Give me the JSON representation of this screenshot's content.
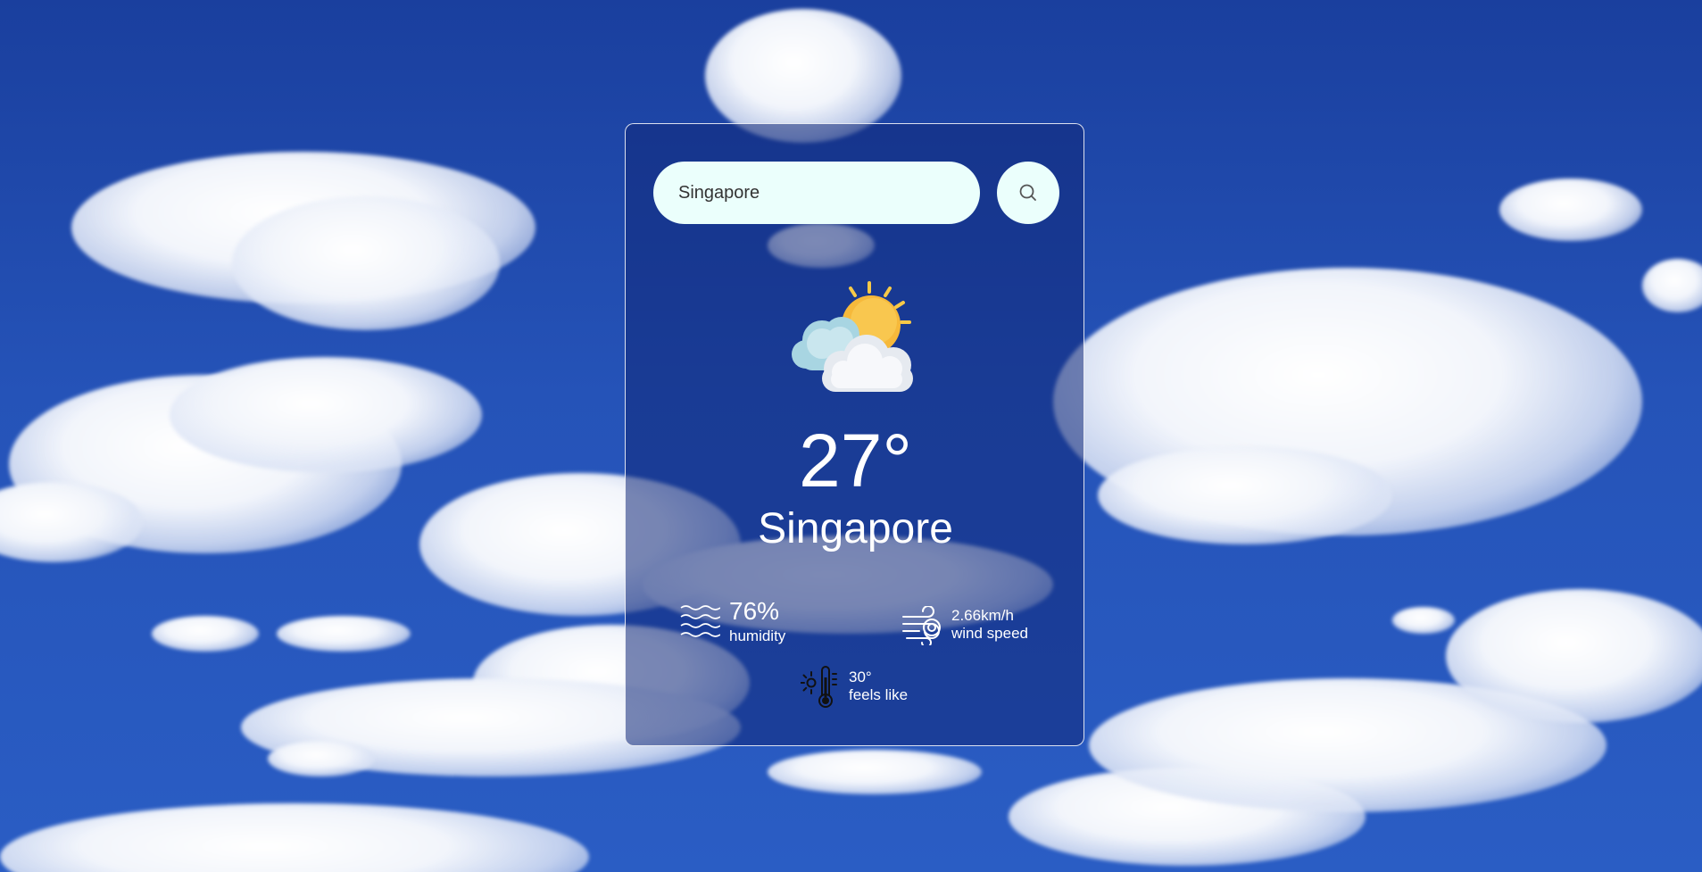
{
  "search": {
    "value": "Singapore",
    "placeholder": "",
    "button_icon": "search-icon"
  },
  "weather": {
    "icon": "partly-cloudy-sun-icon",
    "temperature": "27°",
    "city": "Singapore"
  },
  "stats": {
    "humidity": {
      "icon": "humidity-waves-icon",
      "value": "76%",
      "label": "humidity"
    },
    "wind": {
      "icon": "wind-icon",
      "value": "2.66km/h",
      "label": "wind speed"
    },
    "feels_like": {
      "icon": "thermometer-sun-icon",
      "value": "30°",
      "label": "feels like"
    }
  },
  "colors": {
    "sky": "#2553b8",
    "input_bg": "#ebfffc",
    "text": "#ffffff"
  }
}
